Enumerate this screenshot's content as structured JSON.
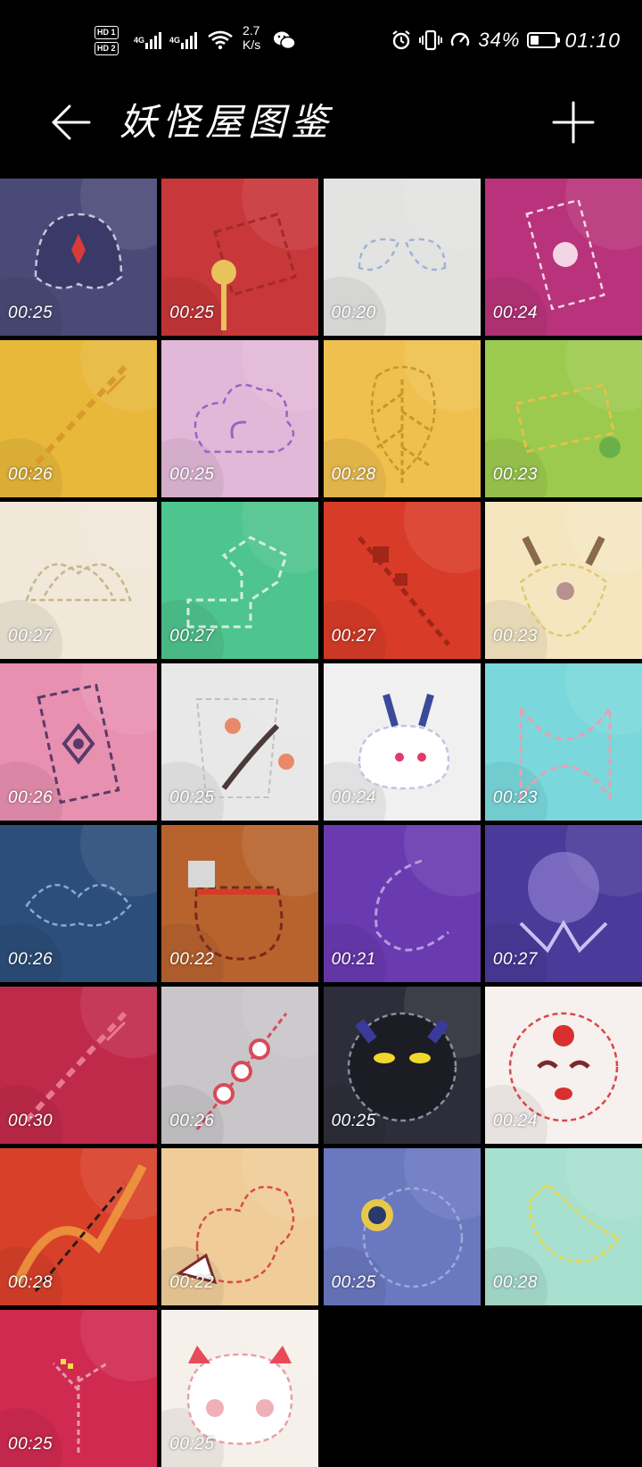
{
  "status_bar": {
    "hd1": "HD 1",
    "hd2": "HD 2",
    "net1": "4G",
    "net2": "4G",
    "speed_value": "2.7",
    "speed_unit": "K/s",
    "battery_text": "34%",
    "battery_level": 0.34,
    "time": "01:10",
    "icons": [
      "signal-icon",
      "signal-icon",
      "wifi-icon",
      "wechat-icon",
      "alarm-icon",
      "vibrate-icon",
      "nfc-icon",
      "battery-icon"
    ]
  },
  "header": {
    "title": "妖怪屋图鉴",
    "back_icon": "back-arrow-icon",
    "add_icon": "plus-icon"
  },
  "gallery": {
    "items": [
      {
        "duration": "00:25",
        "bg": "#4a4a78",
        "accent": "#c8c2d8",
        "shape": "mask"
      },
      {
        "duration": "00:25",
        "bg": "#c8373a",
        "accent": "#e8c25a",
        "shape": "key"
      },
      {
        "duration": "00:20",
        "bg": "#e3e4e2",
        "accent": "#9fb2d6",
        "shape": "wings"
      },
      {
        "duration": "00:24",
        "bg": "#b8337b",
        "accent": "#f2d6e6",
        "shape": "card"
      },
      {
        "duration": "00:26",
        "bg": "#e8b83a",
        "accent": "#d89a2a",
        "shape": "sword"
      },
      {
        "duration": "00:25",
        "bg": "#e2b8d8",
        "accent": "#9a62c8",
        "shape": "cloud"
      },
      {
        "duration": "00:28",
        "bg": "#efc04e",
        "accent": "#c9962a",
        "shape": "leaf"
      },
      {
        "duration": "00:23",
        "bg": "#9cca4e",
        "accent": "#e0c24a",
        "shape": "scroll"
      },
      {
        "duration": "00:27",
        "bg": "#f0e8d8",
        "accent": "#c9b48a",
        "shape": "lotus"
      },
      {
        "duration": "00:27",
        "bg": "#4ec48e",
        "accent": "#d2f0dc",
        "shape": "castle"
      },
      {
        "duration": "00:27",
        "bg": "#d83c28",
        "accent": "#a02618",
        "shape": "spear"
      },
      {
        "duration": "00:23",
        "bg": "#f5e6c0",
        "accent": "#e0c870",
        "shape": "deer"
      },
      {
        "duration": "00:26",
        "bg": "#e890b0",
        "accent": "#5a3a6a",
        "shape": "talisman"
      },
      {
        "duration": "00:25",
        "bg": "#e8e8e8",
        "accent": "#c0c0c0",
        "shape": "branch"
      },
      {
        "duration": "00:24",
        "bg": "#f0f0f0",
        "accent": "#bfc6e0",
        "shape": "rabbit"
      },
      {
        "duration": "00:23",
        "bg": "#7ad8dc",
        "accent": "#e8a0b0",
        "shape": "ribbon"
      },
      {
        "duration": "00:26",
        "bg": "#2c4e7a",
        "accent": "#8aa8d8",
        "shape": "bat"
      },
      {
        "duration": "00:22",
        "bg": "#b8632e",
        "accent": "#7a2a1a",
        "shape": "sack"
      },
      {
        "duration": "00:21",
        "bg": "#6a3ab0",
        "accent": "#b89ae0",
        "shape": "moon"
      },
      {
        "duration": "00:27",
        "bg": "#4a3a9a",
        "accent": "#8a7ad0",
        "shape": "jelly"
      },
      {
        "duration": "00:30",
        "bg": "#c02a4a",
        "accent": "#e87890",
        "shape": "sword"
      },
      {
        "duration": "00:26",
        "bg": "#c8c6c8",
        "accent": "#d84a5a",
        "shape": "skewer"
      },
      {
        "duration": "00:25",
        "bg": "#2e2e3a",
        "accent": "#8a8aa0",
        "shape": "cat"
      },
      {
        "duration": "00:24",
        "bg": "#f6f0ee",
        "accent": "#d84848",
        "shape": "face"
      },
      {
        "duration": "00:28",
        "bg": "#d8402a",
        "accent": "#f0a040",
        "shape": "flame"
      },
      {
        "duration": "00:22",
        "bg": "#f0cc98",
        "accent": "#d84a4a",
        "shape": "gourd"
      },
      {
        "duration": "00:25",
        "bg": "#6a78c0",
        "accent": "#a0a8d8",
        "shape": "eye"
      },
      {
        "duration": "00:28",
        "bg": "#a8e0d0",
        "accent": "#e8d84a",
        "shape": "fish"
      },
      {
        "duration": "00:25",
        "bg": "#d02a50",
        "accent": "#e89aaa",
        "shape": "tree"
      },
      {
        "duration": "00:25",
        "bg": "#f6f0ea",
        "accent": "#e8a0a8",
        "shape": "blob"
      }
    ]
  }
}
